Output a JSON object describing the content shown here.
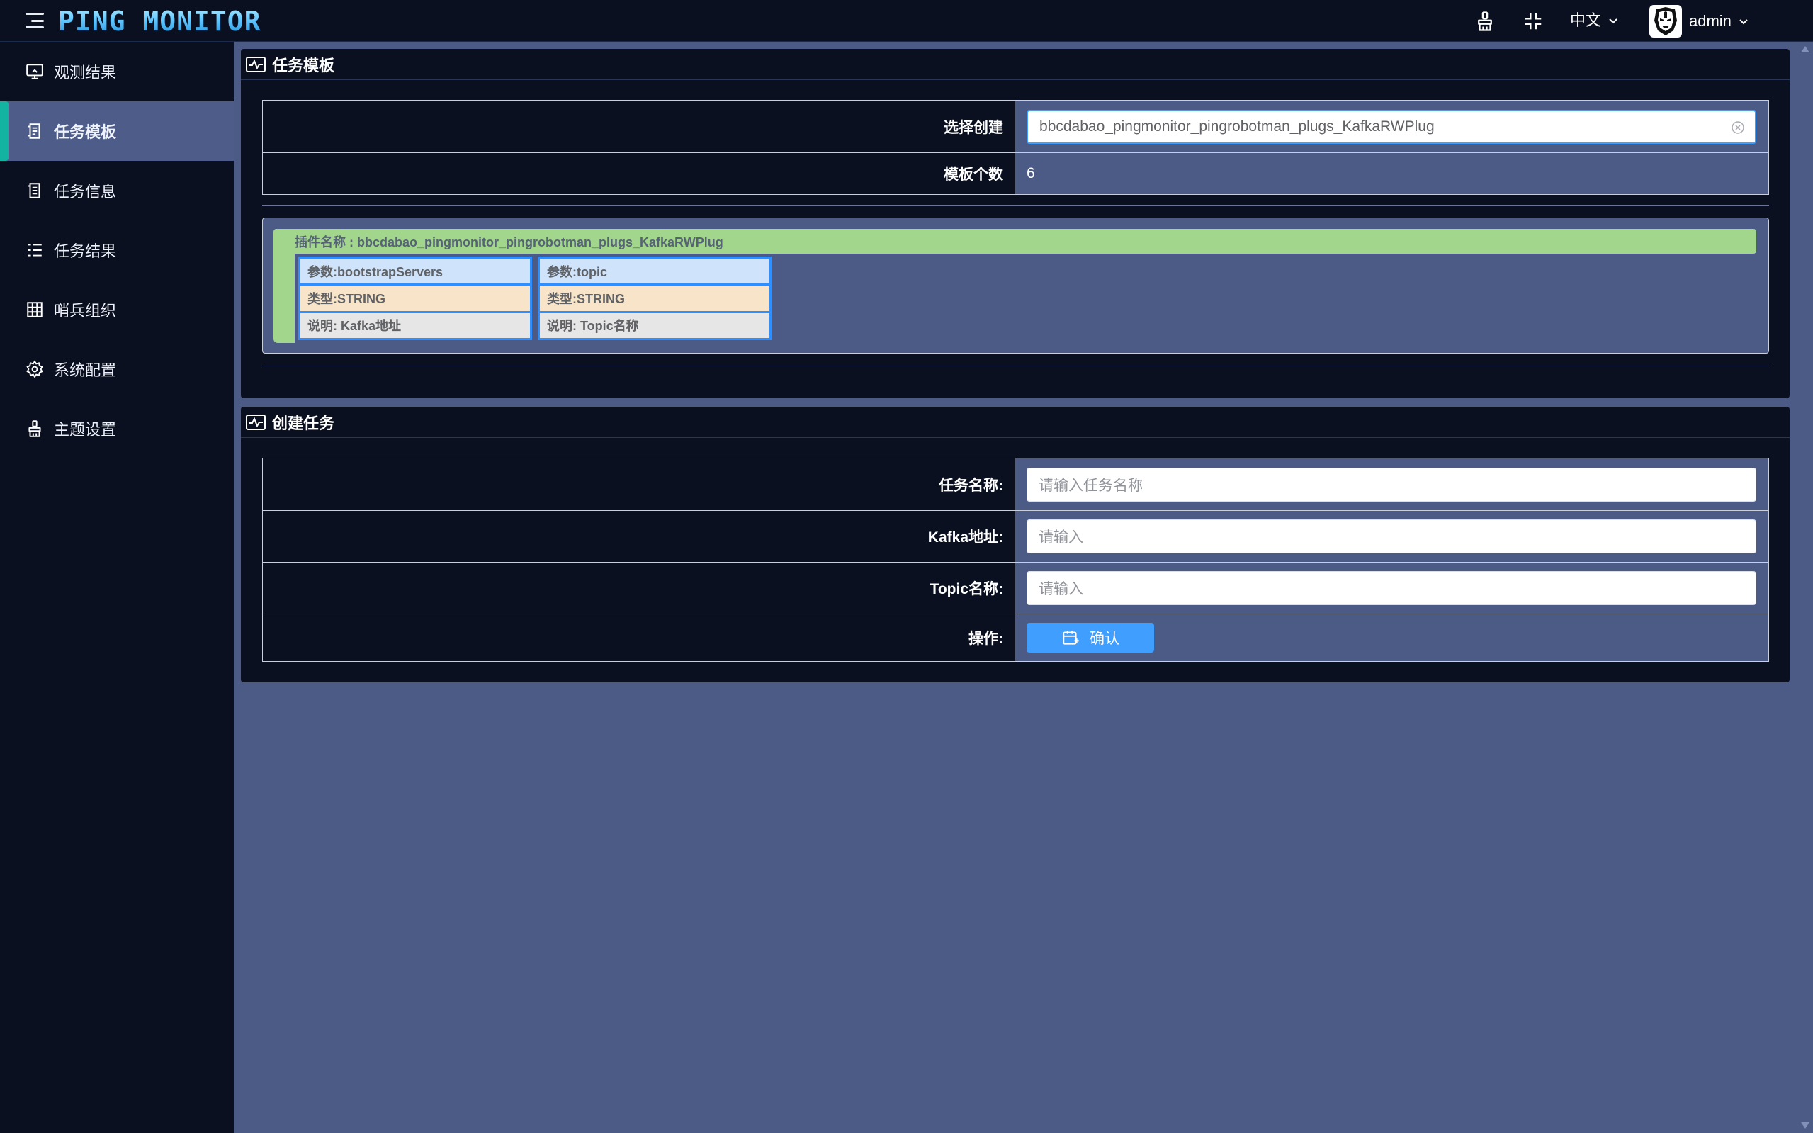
{
  "app": {
    "logo_text": "PING MONITOR",
    "language": "中文",
    "user_name": "admin"
  },
  "icons": {
    "menu": "hamburger-icon",
    "theme": "paint-brush-icon",
    "fullscreen": "compress-icon",
    "avatar": "iron-man-avatar-icon"
  },
  "sidebar": {
    "items": [
      {
        "label": "观测结果",
        "icon": "monitor-icon"
      },
      {
        "label": "任务模板",
        "icon": "template-icon",
        "active": true
      },
      {
        "label": "任务信息",
        "icon": "document-icon"
      },
      {
        "label": "任务结果",
        "icon": "list-icon"
      },
      {
        "label": "哨兵组织",
        "icon": "grid-icon"
      },
      {
        "label": "系统配置",
        "icon": "gear-icon"
      },
      {
        "label": "主题设置",
        "icon": "paint-brush-icon"
      }
    ]
  },
  "template_panel": {
    "title": "任务模板",
    "select_label": "选择创建",
    "select_value": "bbcdabao_pingmonitor_pingrobotman_plugs_KafkaRWPlug",
    "count_label": "模板个数",
    "count_value": "6",
    "plugin": {
      "name_label": "插件名称 : bbcdabao_pingmonitor_pingrobotman_plugs_KafkaRWPlug",
      "params": [
        {
          "name": "参数:bootstrapServers",
          "type": "类型:STRING",
          "desc": "说明: Kafka地址"
        },
        {
          "name": "参数:topic",
          "type": "类型:STRING",
          "desc": "说明: Topic名称"
        }
      ]
    }
  },
  "create_panel": {
    "title": "创建任务",
    "fields": [
      {
        "label": "任务名称:",
        "placeholder": "请输入任务名称"
      },
      {
        "label": "Kafka地址:",
        "placeholder": "请输入"
      },
      {
        "label": "Topic名称:",
        "placeholder": "请输入"
      }
    ],
    "action_label": "操作:",
    "confirm_label": "确认"
  },
  "colors": {
    "sidebar_bg": "#0b1021",
    "content_bg": "#4b5b86",
    "active_accent": "#12b3a1",
    "primary": "#409eff",
    "plugin_header": "#a3d68d"
  }
}
